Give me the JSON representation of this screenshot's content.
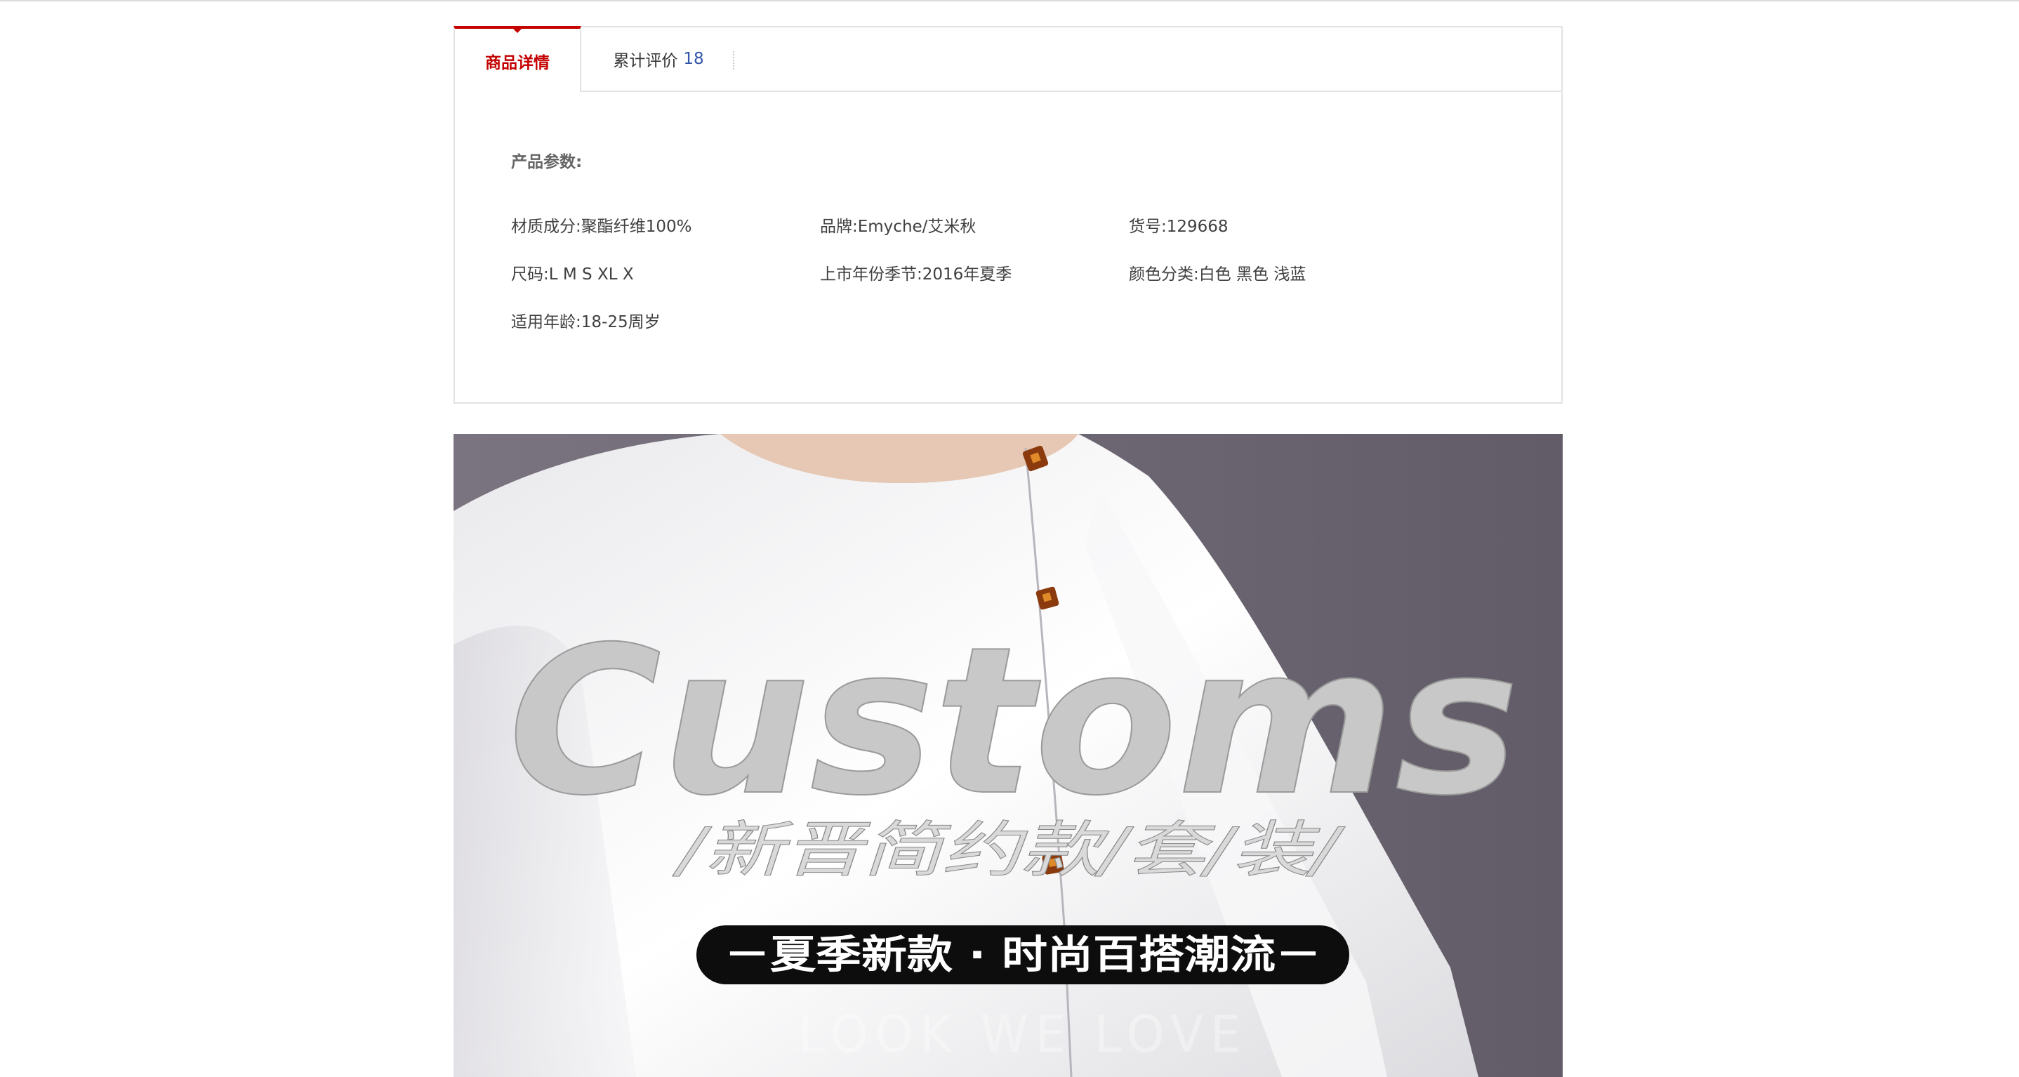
{
  "tabs": {
    "detail_label": "商品详情",
    "reviews_label": "累计评价",
    "reviews_count": "18"
  },
  "params": {
    "title": "产品参数:",
    "rows": [
      [
        "材质成分:聚酯纤维100%",
        "品牌:Emyche/艾米秋",
        "货号:129668"
      ],
      [
        "尺码:L M S XL X",
        "上市年份季节:2016年夏季",
        "颜色分类:白色 黑色 浅蓝"
      ],
      [
        "适用年龄:18-25周岁"
      ]
    ]
  },
  "banner": {
    "headline": "Customs",
    "subtitle": "/新晋简约款/套/装/",
    "pill_text": "－夏季新款 · 时尚百搭潮流－",
    "footer_text": "LOOK WE LOVE"
  },
  "colors": {
    "accent": "#c40000",
    "count": "#3355aa",
    "border": "#e3e3e3",
    "banner_bg": "#6b6570"
  }
}
